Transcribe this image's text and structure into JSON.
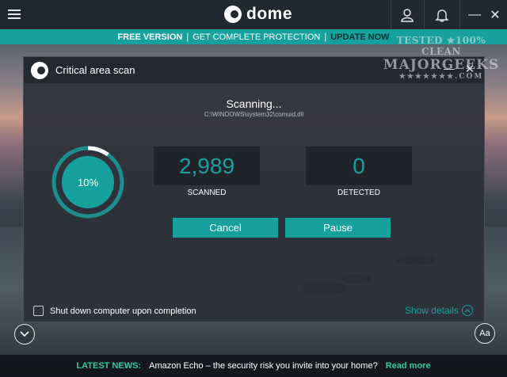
{
  "app": {
    "name": "dome",
    "brand_color": "#16a19f"
  },
  "topbar": {
    "menu_icon": "hamburger-icon",
    "user_icon": "user-icon",
    "notifications_icon": "bell-icon",
    "minimize_glyph": "—",
    "close_glyph": "✕"
  },
  "promo": {
    "free_version": "FREE VERSION",
    "separator": "|",
    "complete_protection": "GET COMPLETE PROTECTION",
    "update_now": "UPDATE NOW"
  },
  "dialog": {
    "title": "Critical area scan",
    "minimize_glyph": "—",
    "close_glyph": "✕",
    "scan_status": "Scanning...",
    "scan_path": "C:\\WINDOWS\\system32\\comuid.dll",
    "progress_label": "10%",
    "progress_fraction": 0.1,
    "scanned_value": "2,989",
    "scanned_label": "SCANNED",
    "detected_value": "0",
    "detected_label": "DETECTED",
    "cancel_label": "Cancel",
    "pause_label": "Pause",
    "shutdown_label": "Shut down computer upon completion",
    "shutdown_checked": false,
    "show_details_label": "Show details"
  },
  "bottom": {
    "expand_icon": "chevron-down-icon",
    "font_button_label": "Aa"
  },
  "news": {
    "tag": "LATEST NEWS:",
    "headline": "Amazon Echo – the security risk you invite into your home?",
    "read_more": "Read more"
  },
  "watermark": {
    "line1": "TESTED ★100% CLEAN",
    "line2": "MAJORGEEKS",
    "line3": "★★★★★★★.COM"
  }
}
